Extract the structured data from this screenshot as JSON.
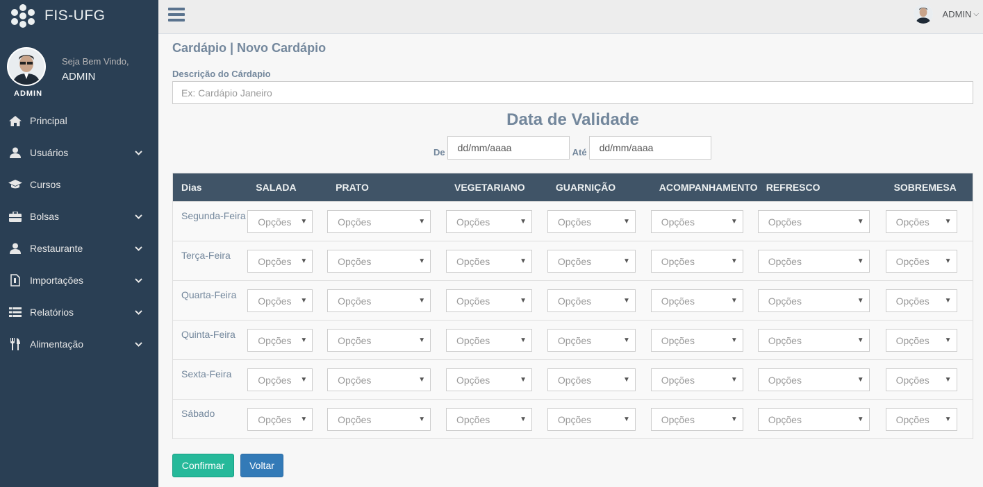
{
  "brand": {
    "title": "FIS-UFG"
  },
  "profile": {
    "welcome": "Seja Bem Vindo,",
    "name": "ADMIN",
    "role": "ADMIN"
  },
  "sidebar": {
    "items": [
      {
        "label": "Principal",
        "icon": "home-icon",
        "has_submenu": false
      },
      {
        "label": "Usuários",
        "icon": "user-icon",
        "has_submenu": true
      },
      {
        "label": "Cursos",
        "icon": "graduation-cap-icon",
        "has_submenu": false
      },
      {
        "label": "Bolsas",
        "icon": "briefcase-icon",
        "has_submenu": true
      },
      {
        "label": "Restaurante",
        "icon": "user-icon",
        "has_submenu": true
      },
      {
        "label": "Importações",
        "icon": "file-icon",
        "has_submenu": true
      },
      {
        "label": "Relatórios",
        "icon": "list-icon",
        "has_submenu": true
      },
      {
        "label": "Alimentação",
        "icon": "utensils-icon",
        "has_submenu": true
      }
    ]
  },
  "topnav": {
    "user_name": "ADMIN"
  },
  "page": {
    "title": "Cardápio | Novo Cardápio",
    "description_label": "Descrição do Cárdapio",
    "description_placeholder": "Ex: Cardápio Janeiro",
    "validity_title": "Data de Validade",
    "from_label": "De",
    "to_label": "Até",
    "date_placeholder": "dd/mm/aaaa"
  },
  "table": {
    "columns": [
      "Dias",
      "SALADA",
      "PRATO",
      "VEGETARIANO",
      "GUARNIÇÃO",
      "ACOMPANHAMENTO",
      "REFRESCO",
      "SOBREMESA"
    ],
    "days": [
      "Segunda-Feira",
      "Terça-Feira",
      "Quarta-Feira",
      "Quinta-Feira",
      "Sexta-Feira",
      "Sábado"
    ],
    "select_placeholder": "Opções"
  },
  "buttons": {
    "confirm": "Confirmar",
    "back": "Voltar"
  },
  "colors": {
    "sidebar_bg": "#2a3f54",
    "table_header_bg": "#405467",
    "confirm": "#26b99a",
    "back": "#337ab7"
  }
}
